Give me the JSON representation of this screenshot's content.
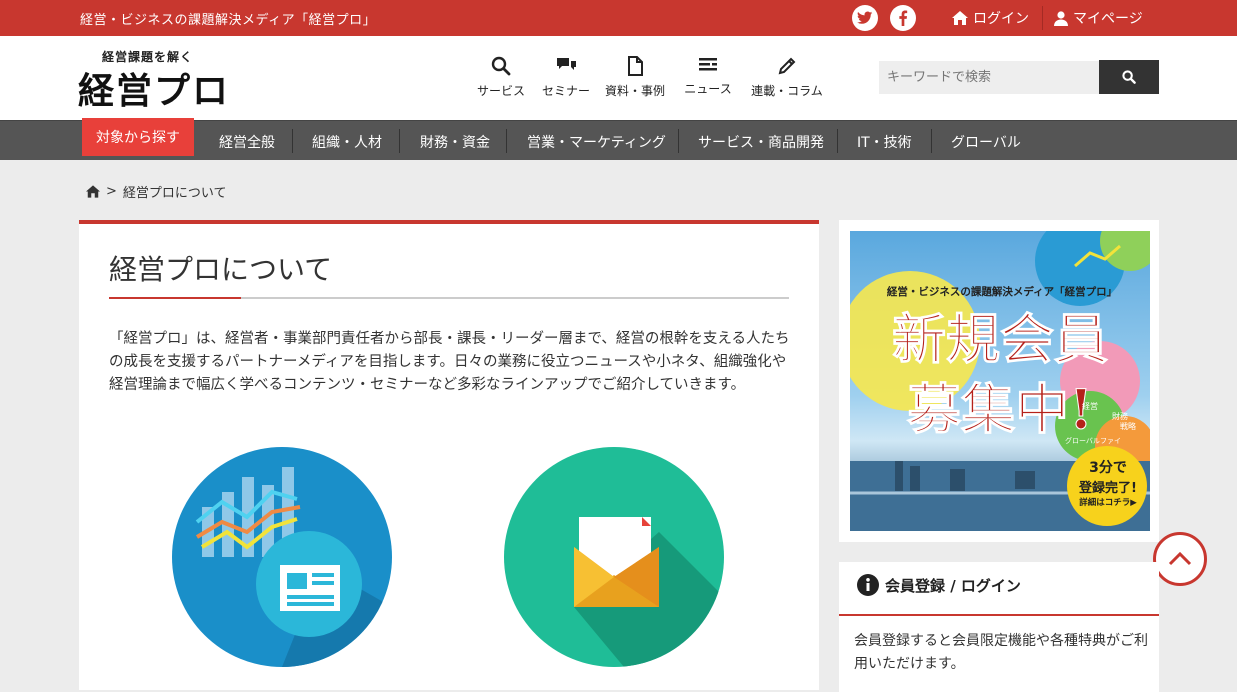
{
  "topbar": {
    "tagline": "経営・ビジネスの課題解決メディア「経営プロ」",
    "login": "ログイン",
    "mypage": "マイページ",
    "bg_color": "#c8372f"
  },
  "header": {
    "logo_sub": "経営課題を解く",
    "logo_main": "経営プロ",
    "nav": [
      {
        "label": "サービス",
        "icon": "search-icon"
      },
      {
        "label": "セミナー",
        "icon": "chat-icon"
      },
      {
        "label": "資料・事例",
        "icon": "document-icon"
      },
      {
        "label": "ニュース",
        "icon": "news-icon"
      },
      {
        "label": "連載・コラム",
        "icon": "pencil-icon"
      }
    ],
    "search_placeholder": "キーワードで検索"
  },
  "catnav": {
    "target": "対象から探す",
    "items": [
      "経営全般",
      "組織・人材",
      "財務・資金",
      "営業・マーケティング",
      "サービス・商品開発",
      "IT・技術",
      "グローバル"
    ]
  },
  "breadcrumb": {
    "separator": ">",
    "current": "経営プロについて"
  },
  "main": {
    "title": "経営プロについて",
    "description": "「経営プロ」は、経営者・事業部門責任者から部長・課長・リーダー層まで、経営の根幹を支える人たちの成長を支援するパートナーメディアを目指します。日々の業務に役立つニュースや小ネタ、組織強化や経営理論まで幅広く学べるコンテンツ・セミナーなど多彩なラインアップでご紹介していきます。"
  },
  "banner": {
    "headline": "経営・ビジネスの課題解決メディア「経営プロ」",
    "big_line1": "新規会員",
    "big_line2": "募集中!",
    "badge_line1": "3分で",
    "badge_line2": "登録完了!",
    "badge_line3": "詳細はコチラ▶",
    "bubble1": "財務",
    "bubble2": "経営",
    "bubble3": "戦略",
    "bubble4": "グローバル",
    "bubble5": "ファイ"
  },
  "member": {
    "heading": "会員登録 / ログイン",
    "text": "会員登録すると会員限定機能や各種特典がご利用いただけます。"
  }
}
